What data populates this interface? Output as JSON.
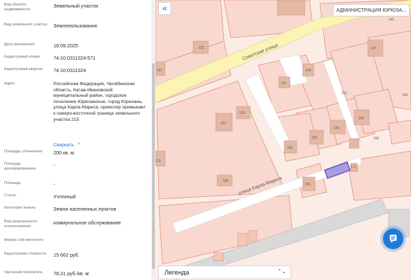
{
  "panel": {
    "rows": [
      {
        "label": "Вид объекта недвижимости",
        "value": "Земельный участок"
      },
      {
        "label": "Вид земельного участка",
        "value": "Землепользование"
      },
      {
        "label": "Дата присвоения",
        "value": "18.09.2025"
      },
      {
        "label": "Кадастровый номер",
        "value": "74:10:0311024:571"
      },
      {
        "label": "Кадастровый квартал",
        "value": "74:10:0311024"
      },
      {
        "label": "Адрес",
        "value": "Российская Федерация, Челябинская область, Катав-Ивановский муниципальный район, городское поселение Юрюзанское, город Юрюзань, улица Карла Маркса, ориентир примыкает к северо-восточной границе земельного участка 215"
      },
      {
        "label": "Площадь уточненная",
        "value": "200 кв. м"
      },
      {
        "label": "Площадь декларированная",
        "value": "-"
      },
      {
        "label": "Площадь",
        "value": "-"
      },
      {
        "label": "Статус",
        "value": "Учтенный"
      },
      {
        "label": "Категория земель",
        "value": "Земли населенных пунктов"
      },
      {
        "label": "Вид разрешенного использования",
        "value": "коммунальное обслуживание"
      },
      {
        "label": "Форма собственности",
        "value": ""
      },
      {
        "label": "Кадастровая стоимость",
        "value": "15 662 руб."
      },
      {
        "label": "Удельный показатель",
        "value": "78,31 руб./кв. м"
      }
    ],
    "collapse_link": "Свернуть",
    "collapse_arrow": "⌃"
  },
  "map": {
    "collapse_button": "«",
    "top_label": "АДМИНИСТРАЦИЯ ЮРЮЗА...",
    "streets": [
      "Советская улица",
      "улица Карла Маркса"
    ],
    "parcel_numbers": [
      "152",
      "147",
      "149",
      "151",
      "153",
      "157",
      "155",
      "150",
      "148",
      "146",
      "158",
      "160",
      "154",
      "156",
      "171",
      "211",
      "166",
      "167",
      "145"
    ],
    "legend": "Легенда",
    "legend_arrow": "⌃⌄",
    "colors": {
      "parcel_fill": "#f9d9cf",
      "parcel_stroke": "#e08c7a",
      "building": "#e3b8a4",
      "road": "#ffffff",
      "main_road": "#fbf4b5",
      "selected_fill": "#a99ce0",
      "selected_stroke": "#5b3fb8",
      "chat": "#1f7bd8"
    }
  }
}
